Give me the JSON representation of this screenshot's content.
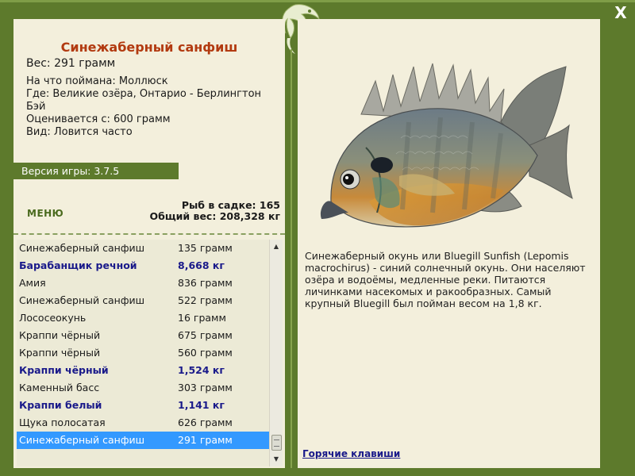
{
  "window": {
    "close_label": "X"
  },
  "fish": {
    "title": "Синежаберный санфиш",
    "weight": "Вес: 291 грамм",
    "info": [
      "На что поймана: Моллюск",
      "Где: Великие озёра, Онтарио - Берлингтон Бэй",
      "Оценивается с: 600 грамм",
      "Вид: Ловится часто"
    ]
  },
  "version": "Версия игры: 3.7.5",
  "menu_label": "МЕНЮ",
  "stats": {
    "fish_count": "Рыб в садке: 165",
    "total_weight": "Общий вес: 208,328 кг"
  },
  "catch_list": [
    {
      "name": "Синежаберный санфиш",
      "weight": "135 грамм",
      "trophy": false
    },
    {
      "name": "Барабанщик речной",
      "weight": "8,668 кг",
      "trophy": true
    },
    {
      "name": "Амия",
      "weight": "836 грамм",
      "trophy": false
    },
    {
      "name": "Синежаберный санфиш",
      "weight": "522 грамм",
      "trophy": false
    },
    {
      "name": "Лососеокунь",
      "weight": "16 грамм",
      "trophy": false
    },
    {
      "name": "Краппи чёрный",
      "weight": "675 грамм",
      "trophy": false
    },
    {
      "name": "Краппи чёрный",
      "weight": "560 грамм",
      "trophy": false
    },
    {
      "name": "Краппи чёрный",
      "weight": "1,524 кг",
      "trophy": true
    },
    {
      "name": "Каменный басс",
      "weight": "303 грамм",
      "trophy": false
    },
    {
      "name": "Краппи белый",
      "weight": "1,141 кг",
      "trophy": true
    },
    {
      "name": "Щука полосатая",
      "weight": "626 грамм",
      "trophy": false
    },
    {
      "name": "Синежаберный санфиш",
      "weight": "291 грамм",
      "trophy": false,
      "selected": true
    }
  ],
  "scroll_up_icon": "▲",
  "scroll_down_icon": "▼",
  "description": "Синежаберный окунь или Bluegill Sunfish (Lepomis macrochirus) - синий солнечный окунь. Они населяют озёра и водоёмы, медленные реки. Питаются личинками насекомых и ракообразных. Самый крупный Bluegill был пойман весом на 1,8 кг.",
  "hotkeys_label": "Горячие клавиши",
  "colors": {
    "frame": "#5d7a2c",
    "panel": "#f3efdc",
    "title": "#b23a10",
    "trophy": "#1a1a8a",
    "selection": "#3399ff"
  },
  "icons": {
    "close": "close-icon",
    "logo": "fish-logo-icon",
    "scroll_up": "arrow-up-icon",
    "scroll_down": "arrow-down-icon"
  }
}
